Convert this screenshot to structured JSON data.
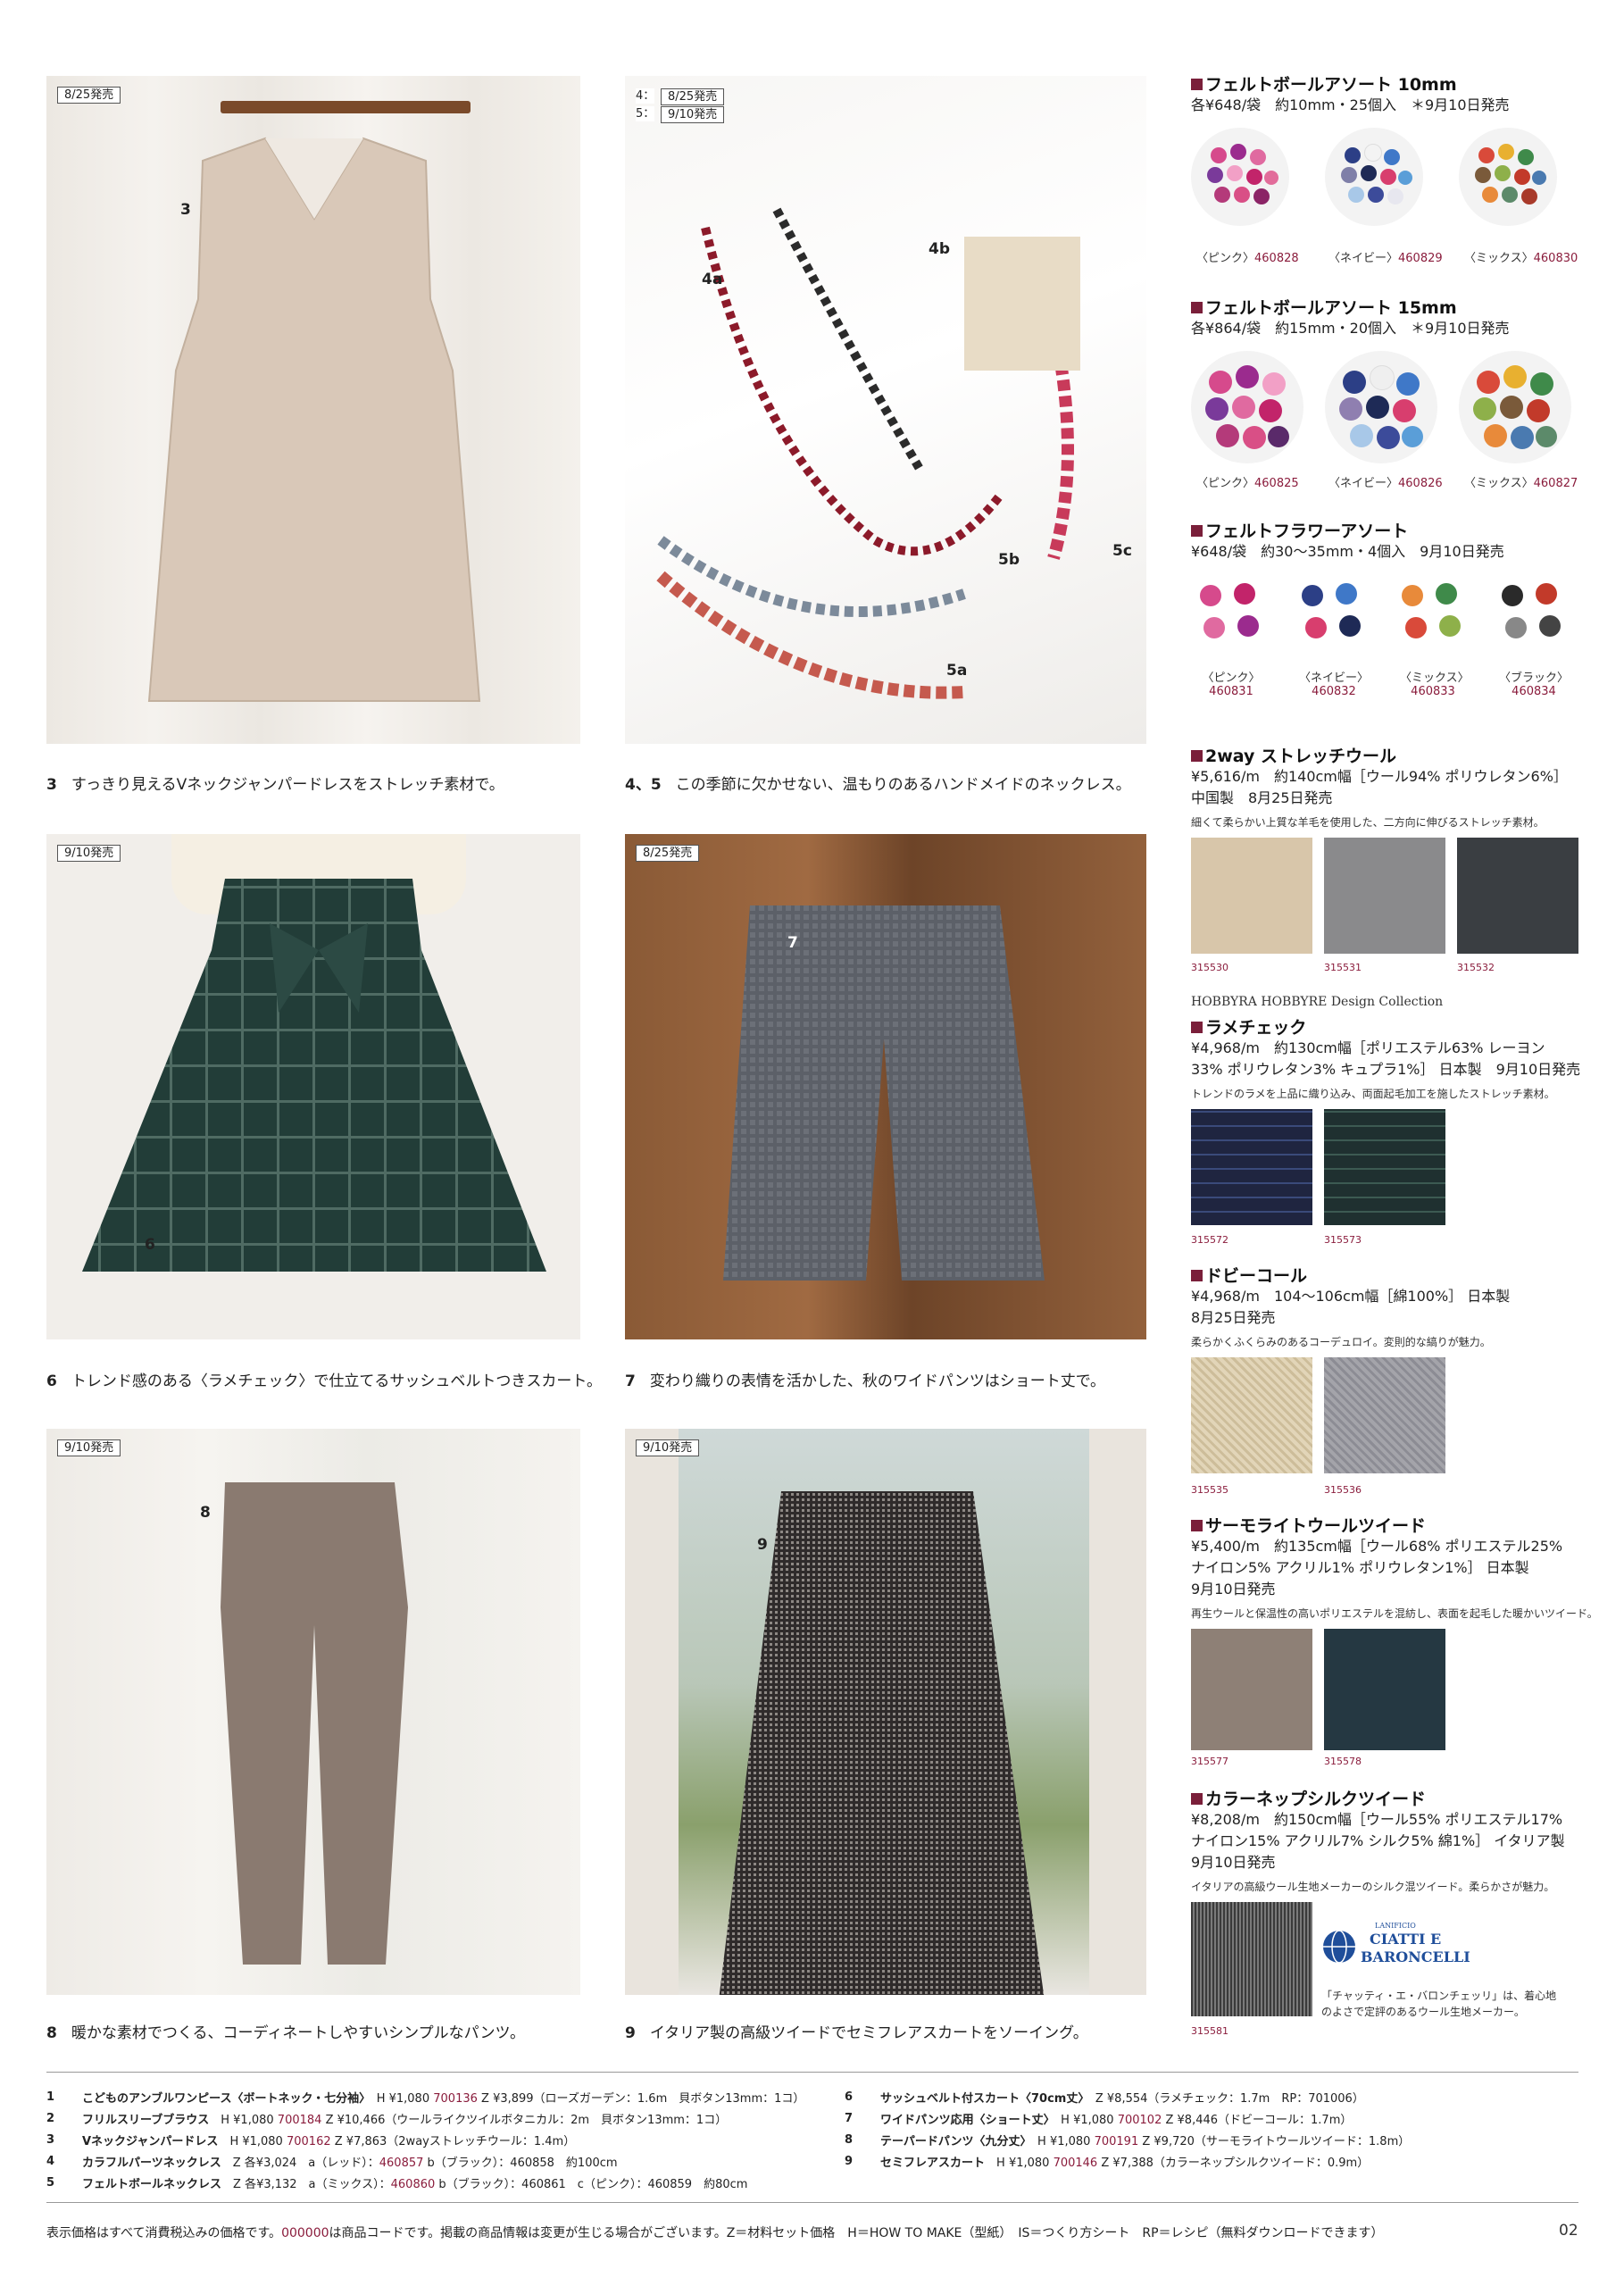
{
  "photos": [
    {
      "badge": "8/25発売",
      "label": "3"
    },
    {
      "badges": [
        "4：",
        "8/25発売",
        "5：",
        "9/10発売"
      ],
      "labels": [
        "4a",
        "4b",
        "5a",
        "5b",
        "5c"
      ]
    },
    {
      "badge": "9/10発売",
      "label": "6"
    },
    {
      "badge": "8/25発売",
      "label": "7"
    },
    {
      "badge": "9/10発売",
      "label": "8"
    },
    {
      "badge": "9/10発売",
      "label": "9"
    }
  ],
  "captions": [
    {
      "num": "3",
      "text": "すっきり見えるVネックジャンパードレスをストレッチ素材で。"
    },
    {
      "num": "4、5",
      "text": "この季節に欠かせない、温もりのあるハンドメイドのネックレス。"
    },
    {
      "num": "6",
      "text": "トレンド感のある〈ラメチェック〉で仕立てるサッシュベルトつきスカート。"
    },
    {
      "num": "7",
      "text": "変わり織りの表情を活かした、秋のワイドパンツはショート丈で。"
    },
    {
      "num": "8",
      "text": "暖かな素材でつくる、コーディネートしやすいシンプルなパンツ。"
    },
    {
      "num": "9",
      "text": "イタリア製の高級ツイードでセミフレアスカートをソーイング。"
    }
  ],
  "right": {
    "felt10": {
      "title": "フェルトボールアソート 10mm",
      "spec": "各¥648/袋　約10mm・25個入　＊9月10日発売",
      "items": [
        {
          "label": "〈ピンク〉",
          "code": "460828"
        },
        {
          "label": "〈ネイビー〉",
          "code": "460829"
        },
        {
          "label": "〈ミックス〉",
          "code": "460830"
        }
      ]
    },
    "felt15": {
      "title": "フェルトボールアソート 15mm",
      "spec": "各¥864/袋　約15mm・20個入　＊9月10日発売",
      "items": [
        {
          "label": "〈ピンク〉",
          "code": "460825"
        },
        {
          "label": "〈ネイビー〉",
          "code": "460826"
        },
        {
          "label": "〈ミックス〉",
          "code": "460827"
        }
      ]
    },
    "flower": {
      "title": "フェルトフラワーアソート",
      "spec": "¥648/袋　約30～35mm・4個入　9月10日発売",
      "items": [
        {
          "label": "〈ピンク〉",
          "code": "460831"
        },
        {
          "label": "〈ネイビー〉",
          "code": "460832"
        },
        {
          "label": "〈ミックス〉",
          "code": "460833"
        },
        {
          "label": "〈ブラック〉",
          "code": "460834"
        }
      ]
    },
    "stretch": {
      "title": "2way ストレッチウール",
      "spec1": "¥5,616/m　約140cm幅［ウール94% ポリウレタン6%］",
      "spec2": "中国製　8月25日発売",
      "desc": "細くて柔らかい上質な羊毛を使用した、二方向に伸びるストレッチ素材。",
      "codes": [
        "315530",
        "315531",
        "315532"
      ]
    },
    "collection": "HOBBYRA HOBBYRE  Design Collection",
    "lame": {
      "title": "ラメチェック",
      "spec1": "¥4,968/m　約130cm幅［ポリエステル63% レーヨン",
      "spec2": "33% ポリウレタン3% キュプラ1%］ 日本製　9月10日発売",
      "desc": "トレンドのラメを上品に織り込み、両面起毛加工を施したストレッチ素材。",
      "codes": [
        "315572",
        "315573"
      ]
    },
    "dobby": {
      "title": "ドビーコール",
      "spec1": "¥4,968/m　104～106cm幅［綿100%］ 日本製",
      "spec2": "8月25日発売",
      "desc": "柔らかくふくらみのあるコーデュロイ。変則的な縞りが魅力。",
      "codes": [
        "315535",
        "315536"
      ]
    },
    "thermo": {
      "title": "サーモライトウールツイード",
      "spec1": "¥5,400/m　約135cm幅［ウール68% ポリエステル25%",
      "spec2": "ナイロン5% アクリル1% ポリウレタン1%］ 日本製",
      "spec3": "9月10日発売",
      "desc": "再生ウールと保温性の高いポリエステルを混紡し、表面を起毛した暖かいツイード。",
      "codes": [
        "315577",
        "315578"
      ]
    },
    "silk": {
      "title": "カラーネップシルクツイード",
      "spec1": "¥8,208/m　約150cm幅［ウール55% ポリエステル17%",
      "spec2": "ナイロン15% アクリル7% シルク5% 綿1%］ イタリア製",
      "spec3": "9月10日発売",
      "desc": "イタリアの高級ウール生地メーカーのシルク混ツイード。柔らかさが魅力。",
      "code": "315581",
      "logo_small": "LANIFICIO",
      "logo_main1": "CIATTI E",
      "logo_main2": "BARONCELLI",
      "note1": "「チャッティ・エ・バロンチェッリ」は、着心地",
      "note2": "のよさで定評のあるウール生地メーカー。"
    }
  },
  "list_left": [
    {
      "n": "1",
      "name": "こどものアンブルワンピース〈ボートネック・七分袖〉",
      "rest": "H ¥1,080",
      "code": "700136",
      "tail": "Z ¥3,899（ローズガーデン：1.6m　貝ボタン13mm：1コ）"
    },
    {
      "n": "2",
      "name": "フリルスリーブブラウス",
      "rest": "H ¥1,080",
      "code": "700184",
      "tail": "Z ¥10,466（ウールライクツイルボタニカル：2m　貝ボタン13mm：1コ）"
    },
    {
      "n": "3",
      "name": "Vネックジャンパードレス",
      "rest": "H ¥1,080",
      "code": "700162",
      "tail": "Z ¥7,863（2wayストレッチウール：1.4m）"
    },
    {
      "n": "4",
      "name": "カラフルパーツネックレス",
      "rest": "Z 各¥3,024　a（レッド）：",
      "code": "460857",
      "tail": "b（ブラック）：460858　約100cm"
    },
    {
      "n": "5",
      "name": "フェルトボールネックレス",
      "rest": "Z 各¥3,132　a（ミックス）：",
      "code": "460860",
      "tail": "b（ブラック）：460861　c（ピンク）：460859　約80cm"
    }
  ],
  "list_right": [
    {
      "n": "6",
      "name": "サッシュベルト付スカート〈70cm丈〉",
      "rest": "",
      "code": "",
      "tail": "Z ¥8,554（ラメチェック：1.7m　RP：701006）"
    },
    {
      "n": "7",
      "name": "ワイドパンツ応用〈ショート丈〉",
      "rest": "H ¥1,080",
      "code": "700102",
      "tail": "Z ¥8,446（ドビーコール：1.7m）"
    },
    {
      "n": "8",
      "name": "テーパードパンツ〈九分丈〉",
      "rest": "H ¥1,080",
      "code": "700191",
      "tail": "Z ¥9,720（サーモライトウールツイード：1.8m）"
    },
    {
      "n": "9",
      "name": "セミフレアスカート",
      "rest": "H ¥1,080",
      "code": "700146",
      "tail": "Z ¥7,388（カラーネップシルクツイード：0.9m）"
    }
  ],
  "footer": {
    "part1": "表示価格はすべて消費税込みの価格です。",
    "code": "000000",
    "part2": "は商品コードです。掲載の商品情報は変更が生じる場合がございます。Z＝材料セット価格　H＝HOW TO MAKE（型紙）　IS＝つくり方シート　RP＝レシピ（無料ダウンロードできます）",
    "page": "02"
  },
  "colors": {
    "accent": "#8a1c3c"
  }
}
